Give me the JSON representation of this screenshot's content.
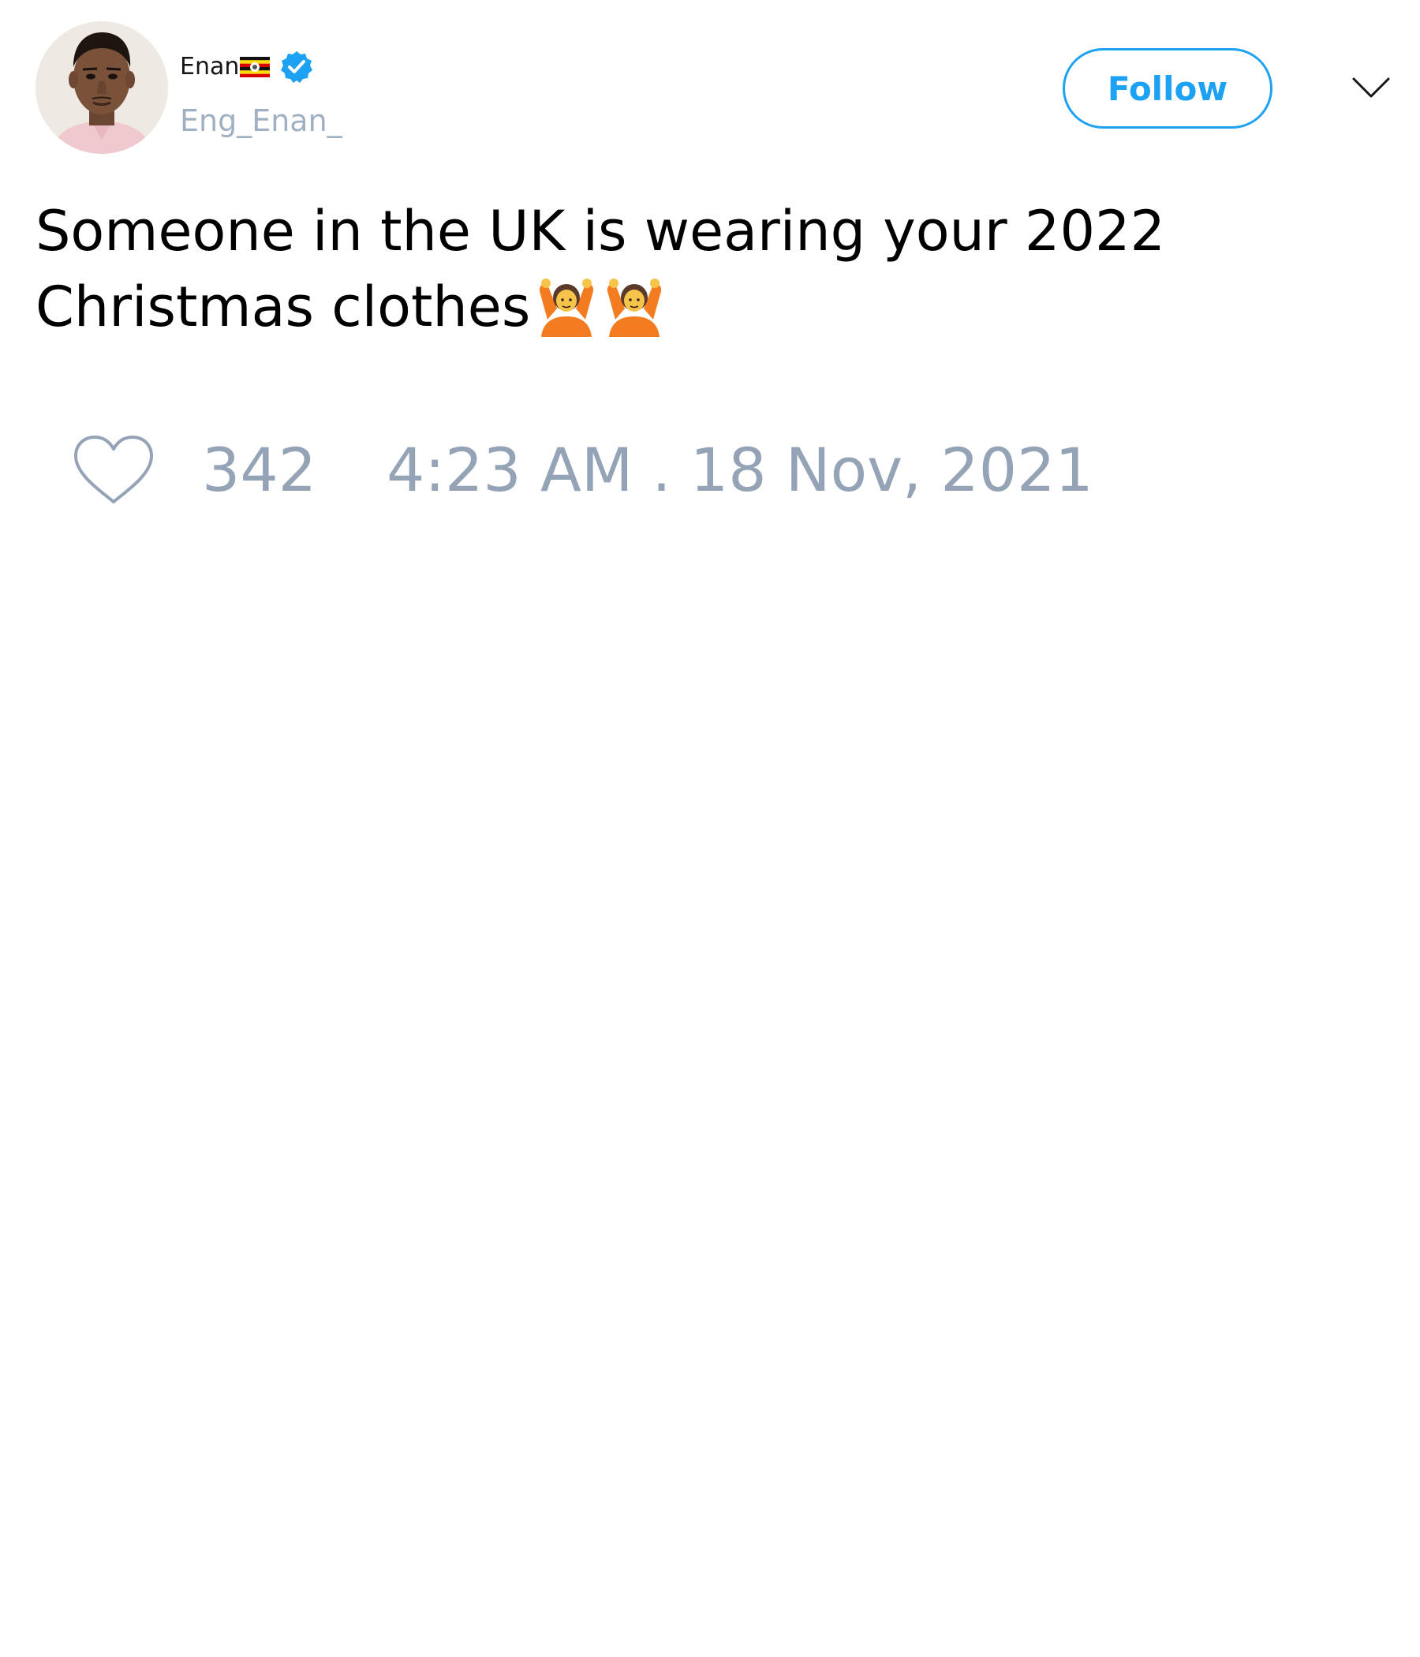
{
  "author": {
    "display_name": "Enan",
    "flag_icon": "uganda-flag-icon",
    "verified_icon": "verified-badge-icon",
    "handle": "Eng_Enan_",
    "avatar_icon": "profile-photo"
  },
  "actions": {
    "follow_label": "Follow",
    "menu_icon": "chevron-down-icon"
  },
  "tweet": {
    "line1": "Someone in the UK is wearing your 2022",
    "line2": "Christmas clothes",
    "emoji_icon": "person-gesturing-ok-icon"
  },
  "stats": {
    "like_icon": "heart-icon",
    "likes": "342",
    "timestamp": "4:23 AM . 18 Nov, 2021"
  },
  "colors": {
    "accent": "#1da1f2",
    "muted_text": "#94a3b5",
    "primary_text": "#000000"
  }
}
